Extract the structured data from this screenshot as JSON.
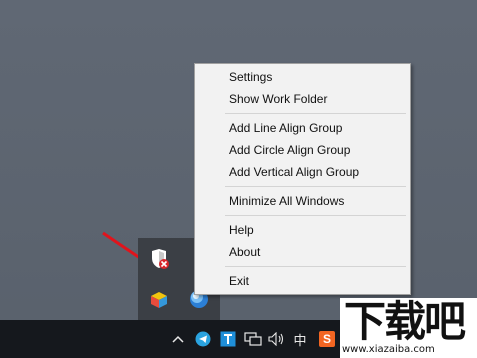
{
  "menu": {
    "items": [
      {
        "label": "Settings"
      },
      {
        "label": "Show Work Folder"
      },
      {
        "label": "Add Line Align Group"
      },
      {
        "label": "Add Circle Align Group"
      },
      {
        "label": "Add Vertical Align Group"
      },
      {
        "label": "Minimize All Windows"
      },
      {
        "label": "Help"
      },
      {
        "label": "About"
      },
      {
        "label": "Exit"
      }
    ]
  },
  "tray": {
    "flyout_icons": [
      "defender-warning-icon",
      "cube-app-icon",
      "desktop-align-app-icon"
    ],
    "taskbar_icons": [
      "show-hidden-icons-chevron",
      "telegram-icon",
      "t-app-icon",
      "network-icon",
      "volume-icon"
    ],
    "ime_label": "中",
    "sogou_label": "S"
  },
  "watermark": {
    "text": "下载吧",
    "url": "www.xiazaiba.com"
  },
  "colors": {
    "desktop": "#5c6470",
    "menu_bg": "#f2f2f2",
    "taskbar": "#15181d",
    "arrow": "#e0141c"
  }
}
